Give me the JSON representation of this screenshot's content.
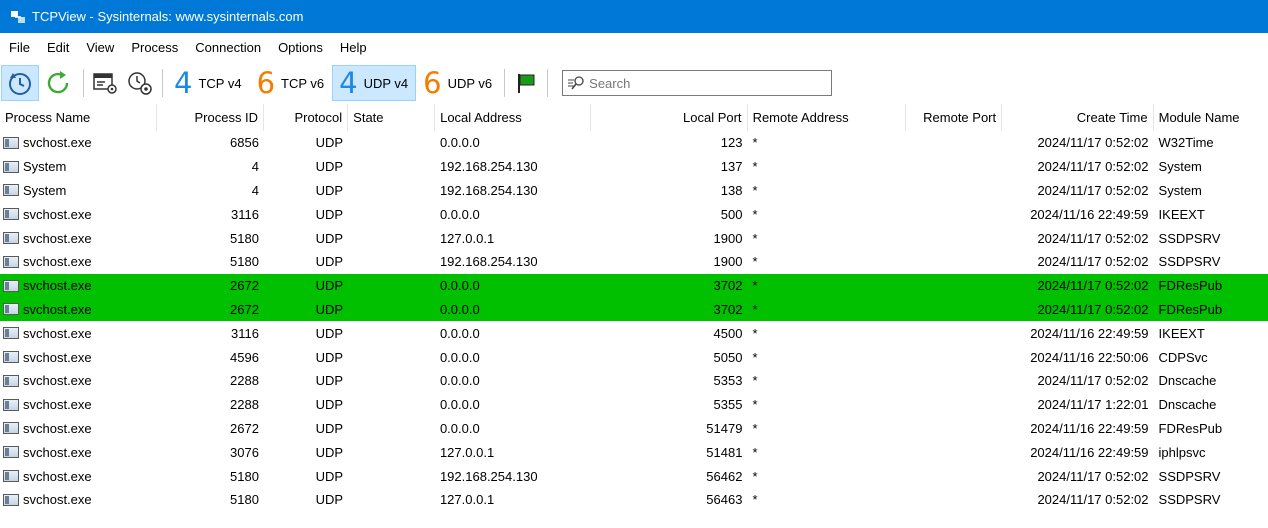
{
  "window": {
    "title": "TCPView - Sysinternals: www.sysinternals.com"
  },
  "menu": [
    "File",
    "Edit",
    "View",
    "Process",
    "Connection",
    "Options",
    "Help"
  ],
  "toolbar": {
    "protocols": [
      {
        "digit": "4",
        "label": "TCP v4",
        "active": false
      },
      {
        "digit": "6",
        "label": "TCP v6",
        "active": false
      },
      {
        "digit": "4",
        "label": "UDP v4",
        "active": true
      },
      {
        "digit": "6",
        "label": "UDP v6",
        "active": false
      }
    ],
    "search_placeholder": "Search"
  },
  "columns": [
    "Process Name",
    "Process ID",
    "Protocol",
    "State",
    "Local Address",
    "Local Port",
    "Remote Address",
    "Remote Port",
    "Create Time",
    "Module Name"
  ],
  "rows": [
    {
      "process": "svchost.exe",
      "pid": "6856",
      "protocol": "UDP",
      "state": "",
      "local_address": "0.0.0.0",
      "local_port": "123",
      "remote_address": "*",
      "remote_port": "",
      "create_time": "2024/11/17 0:52:02",
      "module": "W32Time",
      "highlight": false
    },
    {
      "process": "System",
      "pid": "4",
      "protocol": "UDP",
      "state": "",
      "local_address": "192.168.254.130",
      "local_port": "137",
      "remote_address": "*",
      "remote_port": "",
      "create_time": "2024/11/17 0:52:02",
      "module": "System",
      "highlight": false
    },
    {
      "process": "System",
      "pid": "4",
      "protocol": "UDP",
      "state": "",
      "local_address": "192.168.254.130",
      "local_port": "138",
      "remote_address": "*",
      "remote_port": "",
      "create_time": "2024/11/17 0:52:02",
      "module": "System",
      "highlight": false
    },
    {
      "process": "svchost.exe",
      "pid": "3116",
      "protocol": "UDP",
      "state": "",
      "local_address": "0.0.0.0",
      "local_port": "500",
      "remote_address": "*",
      "remote_port": "",
      "create_time": "2024/11/16 22:49:59",
      "module": "IKEEXT",
      "highlight": false
    },
    {
      "process": "svchost.exe",
      "pid": "5180",
      "protocol": "UDP",
      "state": "",
      "local_address": "127.0.0.1",
      "local_port": "1900",
      "remote_address": "*",
      "remote_port": "",
      "create_time": "2024/11/17 0:52:02",
      "module": "SSDPSRV",
      "highlight": false
    },
    {
      "process": "svchost.exe",
      "pid": "5180",
      "protocol": "UDP",
      "state": "",
      "local_address": "192.168.254.130",
      "local_port": "1900",
      "remote_address": "*",
      "remote_port": "",
      "create_time": "2024/11/17 0:52:02",
      "module": "SSDPSRV",
      "highlight": false
    },
    {
      "process": "svchost.exe",
      "pid": "2672",
      "protocol": "UDP",
      "state": "",
      "local_address": "0.0.0.0",
      "local_port": "3702",
      "remote_address": "*",
      "remote_port": "",
      "create_time": "2024/11/17 0:52:02",
      "module": "FDResPub",
      "highlight": true
    },
    {
      "process": "svchost.exe",
      "pid": "2672",
      "protocol": "UDP",
      "state": "",
      "local_address": "0.0.0.0",
      "local_port": "3702",
      "remote_address": "*",
      "remote_port": "",
      "create_time": "2024/11/17 0:52:02",
      "module": "FDResPub",
      "highlight": true
    },
    {
      "process": "svchost.exe",
      "pid": "3116",
      "protocol": "UDP",
      "state": "",
      "local_address": "0.0.0.0",
      "local_port": "4500",
      "remote_address": "*",
      "remote_port": "",
      "create_time": "2024/11/16 22:49:59",
      "module": "IKEEXT",
      "highlight": false
    },
    {
      "process": "svchost.exe",
      "pid": "4596",
      "protocol": "UDP",
      "state": "",
      "local_address": "0.0.0.0",
      "local_port": "5050",
      "remote_address": "*",
      "remote_port": "",
      "create_time": "2024/11/16 22:50:06",
      "module": "CDPSvc",
      "highlight": false
    },
    {
      "process": "svchost.exe",
      "pid": "2288",
      "protocol": "UDP",
      "state": "",
      "local_address": "0.0.0.0",
      "local_port": "5353",
      "remote_address": "*",
      "remote_port": "",
      "create_time": "2024/11/17 0:52:02",
      "module": "Dnscache",
      "highlight": false
    },
    {
      "process": "svchost.exe",
      "pid": "2288",
      "protocol": "UDP",
      "state": "",
      "local_address": "0.0.0.0",
      "local_port": "5355",
      "remote_address": "*",
      "remote_port": "",
      "create_time": "2024/11/17 1:22:01",
      "module": "Dnscache",
      "highlight": false
    },
    {
      "process": "svchost.exe",
      "pid": "2672",
      "protocol": "UDP",
      "state": "",
      "local_address": "0.0.0.0",
      "local_port": "51479",
      "remote_address": "*",
      "remote_port": "",
      "create_time": "2024/11/16 22:49:59",
      "module": "FDResPub",
      "highlight": false
    },
    {
      "process": "svchost.exe",
      "pid": "3076",
      "protocol": "UDP",
      "state": "",
      "local_address": "127.0.0.1",
      "local_port": "51481",
      "remote_address": "*",
      "remote_port": "",
      "create_time": "2024/11/16 22:49:59",
      "module": "iphlpsvc",
      "highlight": false
    },
    {
      "process": "svchost.exe",
      "pid": "5180",
      "protocol": "UDP",
      "state": "",
      "local_address": "192.168.254.130",
      "local_port": "56462",
      "remote_address": "*",
      "remote_port": "",
      "create_time": "2024/11/17 0:52:02",
      "module": "SSDPSRV",
      "highlight": false
    },
    {
      "process": "svchost.exe",
      "pid": "5180",
      "protocol": "UDP",
      "state": "",
      "local_address": "127.0.0.1",
      "local_port": "56463",
      "remote_address": "*",
      "remote_port": "",
      "create_time": "2024/11/17 0:52:02",
      "module": "SSDPSRV",
      "highlight": false
    }
  ],
  "colors": {
    "title_bar": "#0078d7",
    "highlight": "#00c000",
    "active_toggle": "#cce8ff",
    "v4_digit": "#1e88e5",
    "v6_digit": "#f57c00"
  },
  "icons": [
    "tcpview-app-icon",
    "auto-refresh-icon",
    "refresh-icon",
    "window-settings-icon",
    "process-settings-icon",
    "flag-icon",
    "search-icon",
    "process-icon"
  ]
}
